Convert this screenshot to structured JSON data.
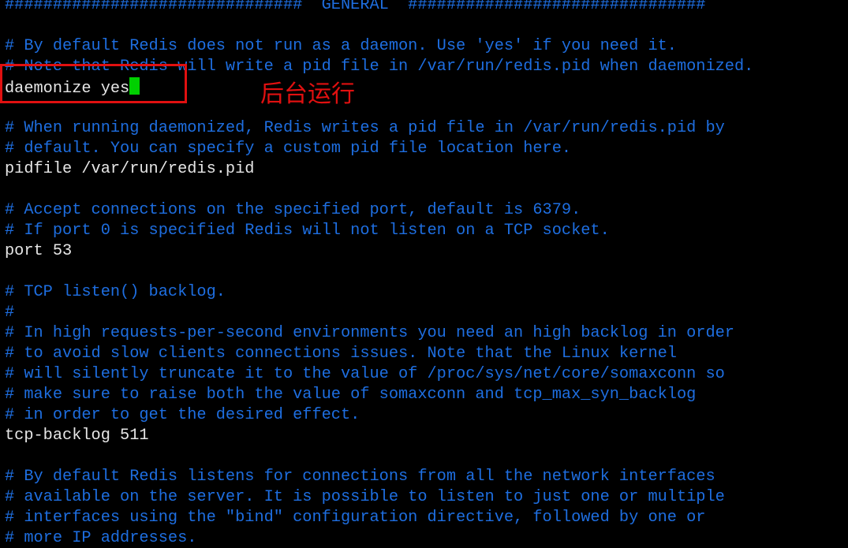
{
  "terminal": {
    "lines": [
      {
        "kind": "comment",
        "text": "###############################  GENERAL  ###############################"
      },
      {
        "kind": "blank",
        "text": ""
      },
      {
        "kind": "comment",
        "text": "# By default Redis does not run as a daemon. Use 'yes' if you need it."
      },
      {
        "kind": "comment",
        "text": "# Note that Redis will write a pid file in /var/run/redis.pid when daemonized."
      },
      {
        "kind": "config",
        "text": "daemonize yes"
      },
      {
        "kind": "blank",
        "text": ""
      },
      {
        "kind": "comment",
        "text": "# When running daemonized, Redis writes a pid file in /var/run/redis.pid by"
      },
      {
        "kind": "comment",
        "text": "# default. You can specify a custom pid file location here."
      },
      {
        "kind": "config",
        "text": "pidfile /var/run/redis.pid"
      },
      {
        "kind": "blank",
        "text": ""
      },
      {
        "kind": "comment",
        "text": "# Accept connections on the specified port, default is 6379."
      },
      {
        "kind": "comment",
        "text": "# If port 0 is specified Redis will not listen on a TCP socket."
      },
      {
        "kind": "config",
        "text": "port 53"
      },
      {
        "kind": "blank",
        "text": ""
      },
      {
        "kind": "comment",
        "text": "# TCP listen() backlog."
      },
      {
        "kind": "comment",
        "text": "#"
      },
      {
        "kind": "comment",
        "text": "# In high requests-per-second environments you need an high backlog in order"
      },
      {
        "kind": "comment",
        "text": "# to avoid slow clients connections issues. Note that the Linux kernel"
      },
      {
        "kind": "comment",
        "text": "# will silently truncate it to the value of /proc/sys/net/core/somaxconn so"
      },
      {
        "kind": "comment",
        "text": "# make sure to raise both the value of somaxconn and tcp_max_syn_backlog"
      },
      {
        "kind": "comment",
        "text": "# in order to get the desired effect."
      },
      {
        "kind": "config",
        "text": "tcp-backlog 511"
      },
      {
        "kind": "blank",
        "text": ""
      },
      {
        "kind": "comment",
        "text": "# By default Redis listens for connections from all the network interfaces"
      },
      {
        "kind": "comment",
        "text": "# available on the server. It is possible to listen to just one or multiple"
      },
      {
        "kind": "comment",
        "text": "# interfaces using the \"bind\" configuration directive, followed by one or"
      },
      {
        "kind": "comment",
        "text": "# more IP addresses."
      }
    ],
    "cursor_line_index": 4,
    "colors": {
      "background": "#000000",
      "comment": "#1e6ee0",
      "config": "#e6e6e6",
      "cursor": "#00d000",
      "annotation": "#e01010"
    }
  },
  "annotation": {
    "label": "后台运行"
  }
}
